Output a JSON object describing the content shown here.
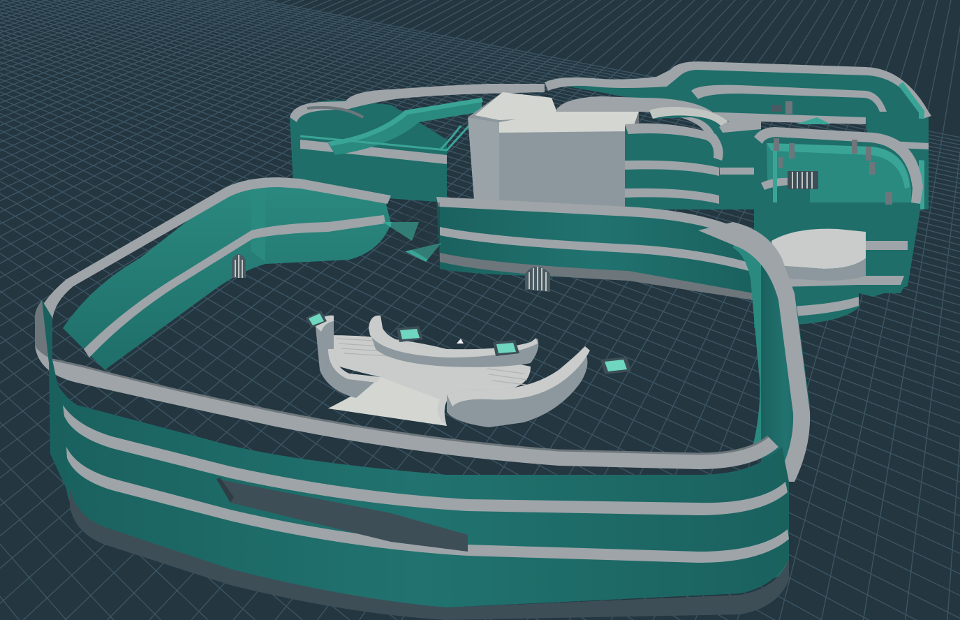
{
  "viewport": {
    "kind": "3d-level-editor-viewport",
    "colors": {
      "background": "#243640",
      "grid_line": "#3c5563",
      "wall_teal": "#1f6e6a",
      "wall_teal_dark": "#195a57",
      "wall_teal_light": "#3aa596",
      "wall_trim": "#9ea4a8",
      "wall_trim_dark": "#6d767b",
      "wall_base": "#3d4e57",
      "floor_light": "#c9ccca",
      "block_face": "#8d989e",
      "block_top": "#d4d6d2",
      "pad_glow": "#6fd6c0"
    },
    "objects": [
      "outer-hall-walls",
      "back-west-wing",
      "center-tower-block",
      "east-wing-loop",
      "east-annex-room",
      "central-staircase",
      "floor-pad",
      "doorway-gate",
      "player-marker"
    ]
  }
}
